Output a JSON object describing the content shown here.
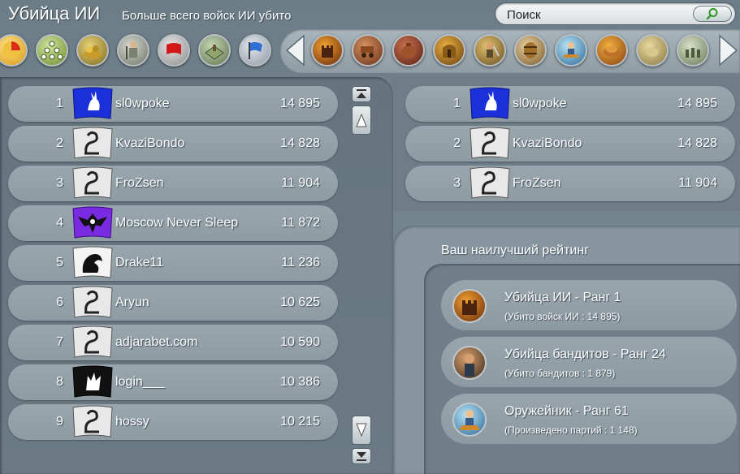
{
  "header": {
    "title": "Убийца ИИ",
    "subtitle": "Больше всего войск ИИ убито"
  },
  "search": {
    "placeholder": "Поиск"
  },
  "category_icons": [
    "pie-chart-icon",
    "molecule-icon",
    "treasure-icon",
    "knight-icon",
    "red-flag-icon",
    "map-icon",
    "blue-flag-icon"
  ],
  "carousel_icons": [
    "castle-fire-icon",
    "cart-icon",
    "bag-icon",
    "gate-icon",
    "bandit-icon",
    "barrel-icon",
    "smith-icon",
    "food-icon",
    "goat-icon",
    "army-icon"
  ],
  "leaderboard": {
    "rows": [
      {
        "rank": "1",
        "name": "sl0wpoke",
        "score": "14 895",
        "flag": "blue-hare-flag"
      },
      {
        "rank": "2",
        "name": "KvaziBondo",
        "score": "14 828",
        "flag": "grey-serpent-flag"
      },
      {
        "rank": "3",
        "name": "FroZsen",
        "score": "11 904",
        "flag": "grey-serpent-flag"
      },
      {
        "rank": "4",
        "name": "Moscow Never Sleep",
        "score": "11 872",
        "flag": "purple-eagle-flag"
      },
      {
        "rank": "5",
        "name": "Drake11",
        "score": "11 236",
        "flag": "white-dragon-flag"
      },
      {
        "rank": "6",
        "name": "Aryun",
        "score": "10 625",
        "flag": "grey-serpent-flag"
      },
      {
        "rank": "7",
        "name": "adjarabet.com",
        "score": "10 590",
        "flag": "grey-serpent-flag"
      },
      {
        "rank": "8",
        "name": "login___",
        "score": "10 386",
        "flag": "black-wolf-flag"
      },
      {
        "rank": "9",
        "name": "hossy",
        "score": "10 215",
        "flag": "grey-serpent-flag"
      }
    ]
  },
  "friends": {
    "rows": [
      {
        "rank": "1",
        "name": "sl0wpoke",
        "score": "14 895",
        "flag": "blue-hare-flag"
      },
      {
        "rank": "2",
        "name": "KvaziBondo",
        "score": "14 828",
        "flag": "grey-serpent-flag"
      },
      {
        "rank": "3",
        "name": "FroZsen",
        "score": "11 904",
        "flag": "grey-serpent-flag"
      }
    ]
  },
  "best_rating": {
    "title": "Ваш наилучший рейтинг",
    "items": [
      {
        "title": "Убийца ИИ - Ранг 1",
        "detail": "(Убито войск ИИ : 14 895)",
        "icon": "castle-fire-icon"
      },
      {
        "title": "Убийца бандитов - Ранг 24",
        "detail": "(Убито бандитов : 1 879)",
        "icon": "bandit-icon"
      },
      {
        "title": "Оружейник - Ранг 61",
        "detail": "(Произведено партий : 1 148)",
        "icon": "smith-icon"
      }
    ]
  }
}
